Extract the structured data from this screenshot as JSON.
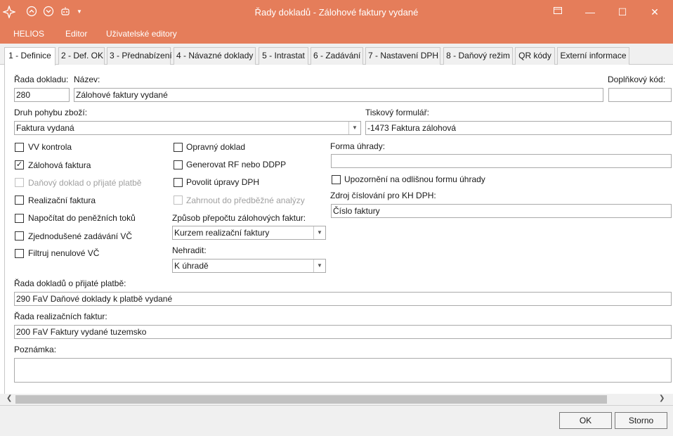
{
  "window": {
    "title": "Řady dokladů - Zálohové faktury vydané"
  },
  "menu": [
    "HELIOS",
    "Editor",
    "Uživatelské editory"
  ],
  "tabs": [
    "1 - Definice",
    "2 - Def. OK",
    "3 - Přednabízení",
    "4 - Návazné doklady",
    "5 - Intrastat",
    "6 - Zadávání",
    "7 - Nastavení DPH",
    "8 - Daňový režim",
    "QR kódy",
    "Externí informace"
  ],
  "form": {
    "rada_label": "Řada dokladu:",
    "rada_value": "280",
    "nazev_label": "Název:",
    "nazev_value": "Zálohové faktury vydané",
    "doplnkovy_label": "Doplňkový kód:",
    "doplnkovy_value": "",
    "druh_label": "Druh pohybu zboží:",
    "druh_value": "Faktura vydaná",
    "tiskovy_label": "Tiskový formulář:",
    "tiskovy_value": "-1473 Faktura zálohová",
    "forma_label": "Forma úhrady:",
    "forma_value": "",
    "upozorneni_label": "Upozornění na odlišnou formu úhrady",
    "zdroj_label": "Zdroj číslování pro KH DPH:",
    "zdroj_value": "Číslo faktury",
    "zpusob_label": "Způsob přepočtu zálohových faktur:",
    "zpusob_value": "Kurzem realizační faktury",
    "nehradit_label": "Nehradit:",
    "nehradit_value": "K úhradě",
    "rada_platba_label": "Řada dokladů o přijaté platbě:",
    "rada_platba_value": "290 FaV Daňové doklady k platbě vydané",
    "rada_realizacnich_label": "Řada realizačních faktur:",
    "rada_realizacnich_value": "200 FaV Faktury vydané tuzemsko",
    "poznamka_label": "Poznámka:",
    "poznamka_value": ""
  },
  "checks_left": [
    {
      "label": "VV kontrola",
      "checked": false,
      "disabled": false
    },
    {
      "label": "Zálohová faktura",
      "checked": true,
      "disabled": false
    },
    {
      "label": "Daňový doklad o přijaté platbě",
      "checked": false,
      "disabled": true
    },
    {
      "label": "Realizační faktura",
      "checked": false,
      "disabled": false
    },
    {
      "label": "Napočítat do peněžních toků",
      "checked": false,
      "disabled": false
    },
    {
      "label": "Zjednodušené zadávání VČ",
      "checked": false,
      "disabled": false
    },
    {
      "label": "Filtruj nenulové VČ",
      "checked": false,
      "disabled": false
    }
  ],
  "checks_mid": [
    {
      "label": "Opravný doklad",
      "checked": false,
      "disabled": false
    },
    {
      "label": "Generovat RF nebo DDPP",
      "checked": false,
      "disabled": false
    },
    {
      "label": "Povolit úpravy DPH",
      "checked": false,
      "disabled": false
    },
    {
      "label": "Zahrnout do předběžné analýzy",
      "checked": false,
      "disabled": true
    }
  ],
  "buttons": {
    "ok": "OK",
    "storno": "Storno"
  },
  "check_glyph": "✓"
}
